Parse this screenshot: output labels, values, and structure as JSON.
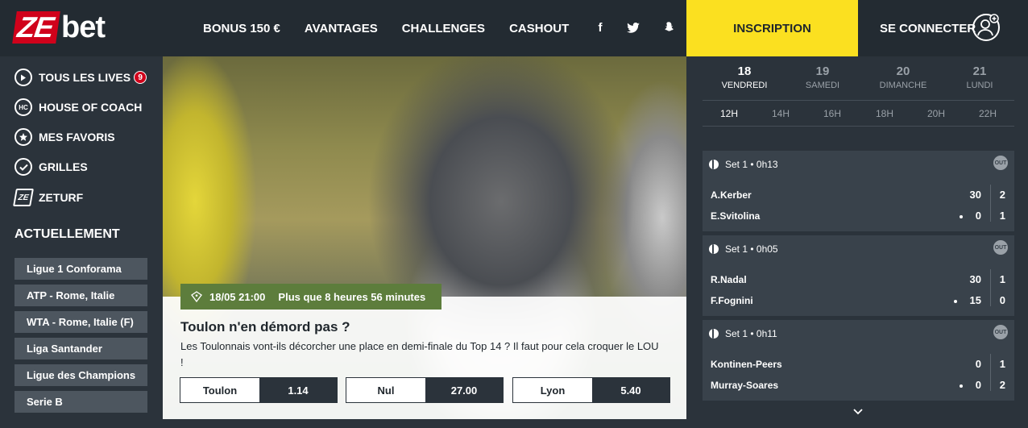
{
  "logo": {
    "ze": "ZE",
    "bet": "bet"
  },
  "nav": [
    "BONUS 150 €",
    "AVANTAGES",
    "CHALLENGES",
    "CASHOUT"
  ],
  "social": {
    "facebook": "f",
    "twitter": "twitter-icon",
    "snapchat": "snapchat-icon"
  },
  "inscription_label": "INSCRIPTION",
  "login_label": "SE CONNECTER",
  "sidebar": {
    "items": [
      {
        "label": "TOUS LES LIVES",
        "icon": "play-icon",
        "badge": "9"
      },
      {
        "label": "HOUSE OF COACH",
        "icon": "hc-icon",
        "icon_text": "HC"
      },
      {
        "label": "MES FAVORIS",
        "icon": "star-icon"
      },
      {
        "label": "GRILLES",
        "icon": "check-icon"
      },
      {
        "label": "ZETURF",
        "icon": "zeturf-icon",
        "icon_text": "ZE"
      }
    ],
    "section_title": "ACTUELLEMENT",
    "leagues": [
      "Ligue 1 Conforama",
      "ATP - Rome, Italie",
      "WTA - Rome, Italie (F)",
      "Liga Santander",
      "Ligue des Champions",
      "Serie B"
    ]
  },
  "hero": {
    "date": "18/05 21:00",
    "countdown": "Plus que 8 heures 56 minutes",
    "title": "Toulon n'en démord pas ?",
    "description": "Les Toulonnais vont-ils décorcher une place en demi-finale du Top 14 ? Il faut pour cela croquer le LOU !",
    "odds": [
      {
        "label": "Toulon",
        "value": "1.14"
      },
      {
        "label": "Nul",
        "value": "27.00"
      },
      {
        "label": "Lyon",
        "value": "5.40"
      }
    ]
  },
  "calendar": {
    "days": [
      {
        "num": "18",
        "name": "VENDREDI",
        "active": true
      },
      {
        "num": "19",
        "name": "SAMEDI",
        "active": false
      },
      {
        "num": "20",
        "name": "DIMANCHE",
        "active": false
      },
      {
        "num": "21",
        "name": "LUNDI",
        "active": false
      }
    ],
    "hours": [
      "12H",
      "14H",
      "16H",
      "18H",
      "20H",
      "22H"
    ],
    "active_hour": "12H"
  },
  "matches": [
    {
      "status": "Set 1 • 0h13",
      "p1": "A.Kerber",
      "p2": "E.Svitolina",
      "p1_game": "30",
      "p2_game": "0",
      "p1_set": "2",
      "p2_set": "1",
      "server": 2
    },
    {
      "status": "Set 1 • 0h05",
      "p1": "R.Nadal",
      "p2": "F.Fognini",
      "p1_game": "30",
      "p2_game": "15",
      "p1_set": "1",
      "p2_set": "0",
      "server": 2
    },
    {
      "status": "Set 1 • 0h11",
      "p1": "Kontinen-Peers",
      "p2": "Murray-Soares",
      "p1_game": "0",
      "p2_game": "0",
      "p1_set": "1",
      "p2_set": "2",
      "server": 2
    }
  ],
  "out_label": "OUT",
  "colors": {
    "brand_red": "#d0021b",
    "inscription_yellow": "#fbe020",
    "hero_tag_green": "#5d7d3c",
    "bg_dark": "#2b333b"
  }
}
